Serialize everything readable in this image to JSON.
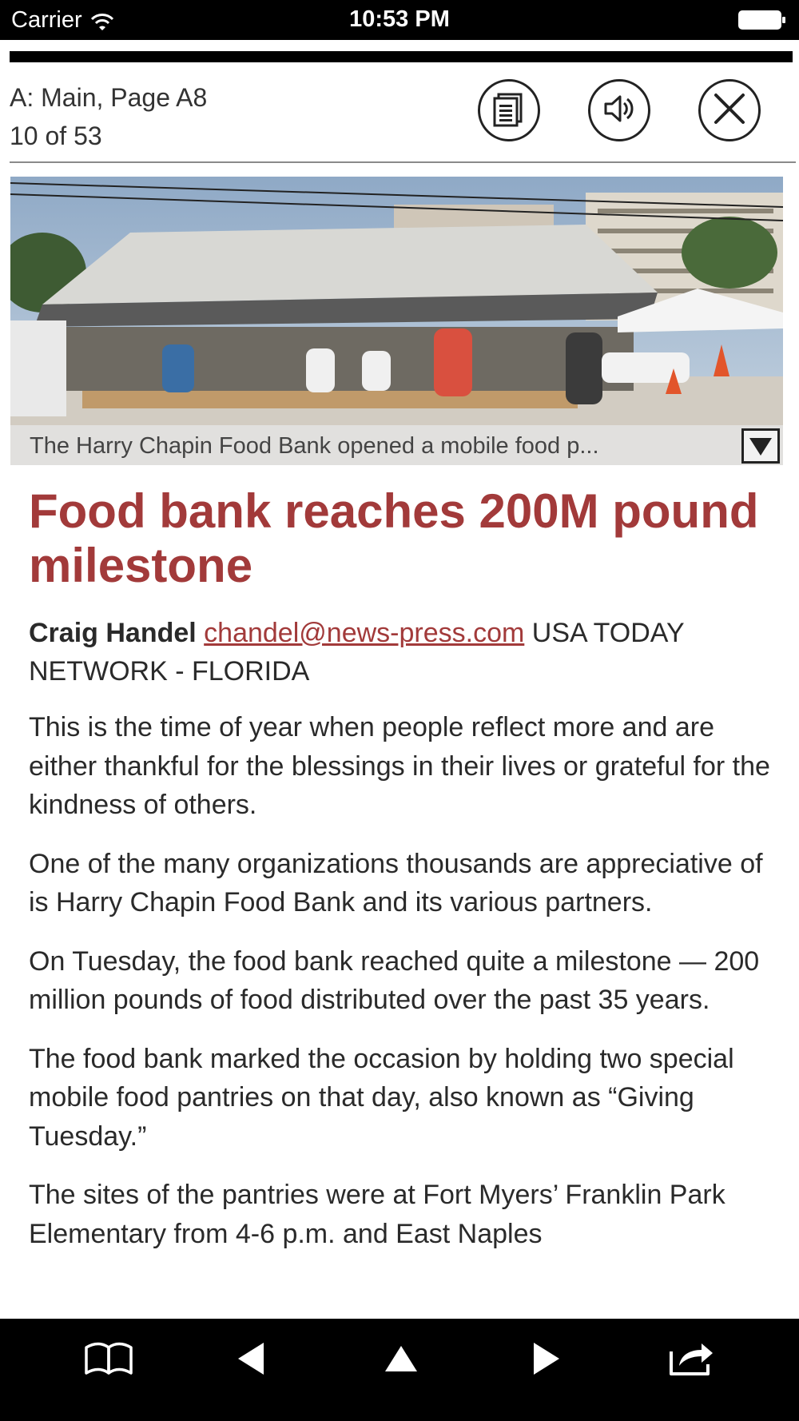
{
  "status_bar": {
    "carrier": "Carrier",
    "time": "10:53 PM"
  },
  "header": {
    "section": "A: Main, Page A8",
    "page_count": "10 of 53",
    "buttons": {
      "text_view_icon": "text-view-icon",
      "audio_icon": "speaker-icon",
      "close_icon": "close-icon"
    }
  },
  "photo": {
    "caption": "The Harry Chapin Food Bank opened a mobile food p...",
    "toggle_icon": "triangle-down-icon"
  },
  "article": {
    "headline": "Food bank reaches 200M pound milestone",
    "byline": {
      "author": "Craig Handel",
      "email": "chandel@news-press.com",
      "affiliation": "USA TODAY NETWORK - FLORIDA"
    },
    "paragraphs": [
      "This is the time of year when people reflect more and are either thankful for the blessings in their lives or grateful for the kindness of others.",
      "One of the many organizations thousands are appreciative of is Harry Chapin Food Bank and its various partners.",
      "On Tuesday, the food bank reached quite a milestone — 200 million pounds of food distributed over the past 35 years.",
      "The food bank marked the occasion by holding two special mobile food pantries on that day, also known as “Giving Tuesday.”",
      "The sites of the pantries were at Fort Myers’ Franklin Park Elementary from 4-6 p.m. and East Naples"
    ]
  },
  "bottom_nav": {
    "icons": [
      "book-icon",
      "previous-icon",
      "up-icon",
      "next-icon",
      "share-icon"
    ]
  },
  "colors": {
    "headline": "#a23a3a",
    "bars": "#000000",
    "body_text": "#2a2a2a"
  }
}
